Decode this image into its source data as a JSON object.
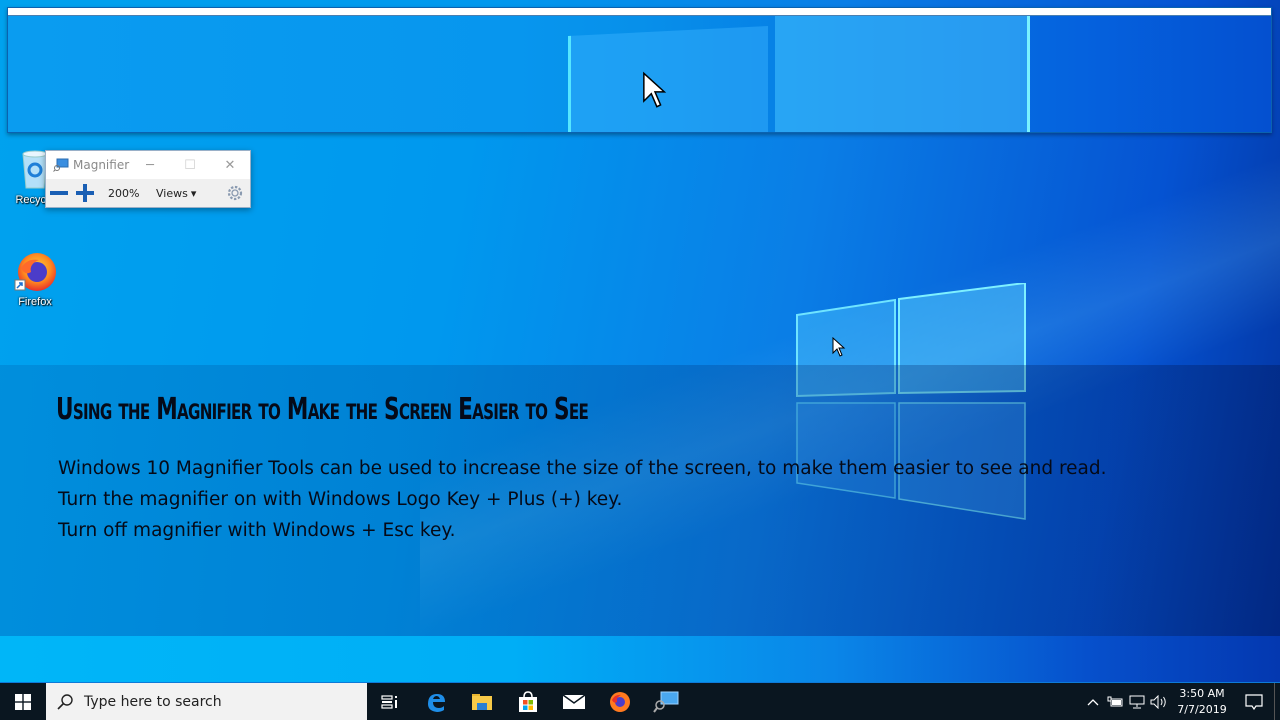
{
  "desktop": {
    "icons": [
      {
        "label": "Recycle Bin",
        "visible_label": "Recycle",
        "icon": "recycle-bin-icon"
      },
      {
        "label": "Firefox",
        "icon": "firefox-icon"
      }
    ]
  },
  "magnifier": {
    "title": "Magnifier",
    "minimize_label": "─",
    "maximize_label": "☐",
    "close_label": "✕",
    "zoom_out_label": "−",
    "zoom_in_label": "+",
    "zoom_level": "200%",
    "views_label": "Views",
    "views_arrow": "▾"
  },
  "overlay": {
    "title": "Using the Magnifier to Make the Screen Easier to See",
    "lines": [
      "Windows 10 Magnifier Tools can be used to increase the size of the screen, to make them easier to see and read.",
      "Turn the magnifier on with Windows Logo Key + Plus (+) key.",
      "Turn off magnifier with Windows + Esc key."
    ]
  },
  "taskbar": {
    "search_placeholder": "Type here to search",
    "pinned": [
      {
        "name": "task-view",
        "icon": "task-view-icon"
      },
      {
        "name": "edge",
        "icon": "edge-icon"
      },
      {
        "name": "file-explorer",
        "icon": "folder-icon"
      },
      {
        "name": "store",
        "icon": "store-icon"
      },
      {
        "name": "mail",
        "icon": "mail-icon"
      },
      {
        "name": "firefox",
        "icon": "firefox-icon"
      },
      {
        "name": "magnifier",
        "icon": "magnifier-icon"
      }
    ],
    "tray": {
      "chevron": "^",
      "time": "3:50 AM",
      "date": "7/7/2019"
    }
  },
  "colors": {
    "accent": "#1a5fb4",
    "taskbar_bg": "#0a1620",
    "desktop_blue": "#0098ee"
  }
}
